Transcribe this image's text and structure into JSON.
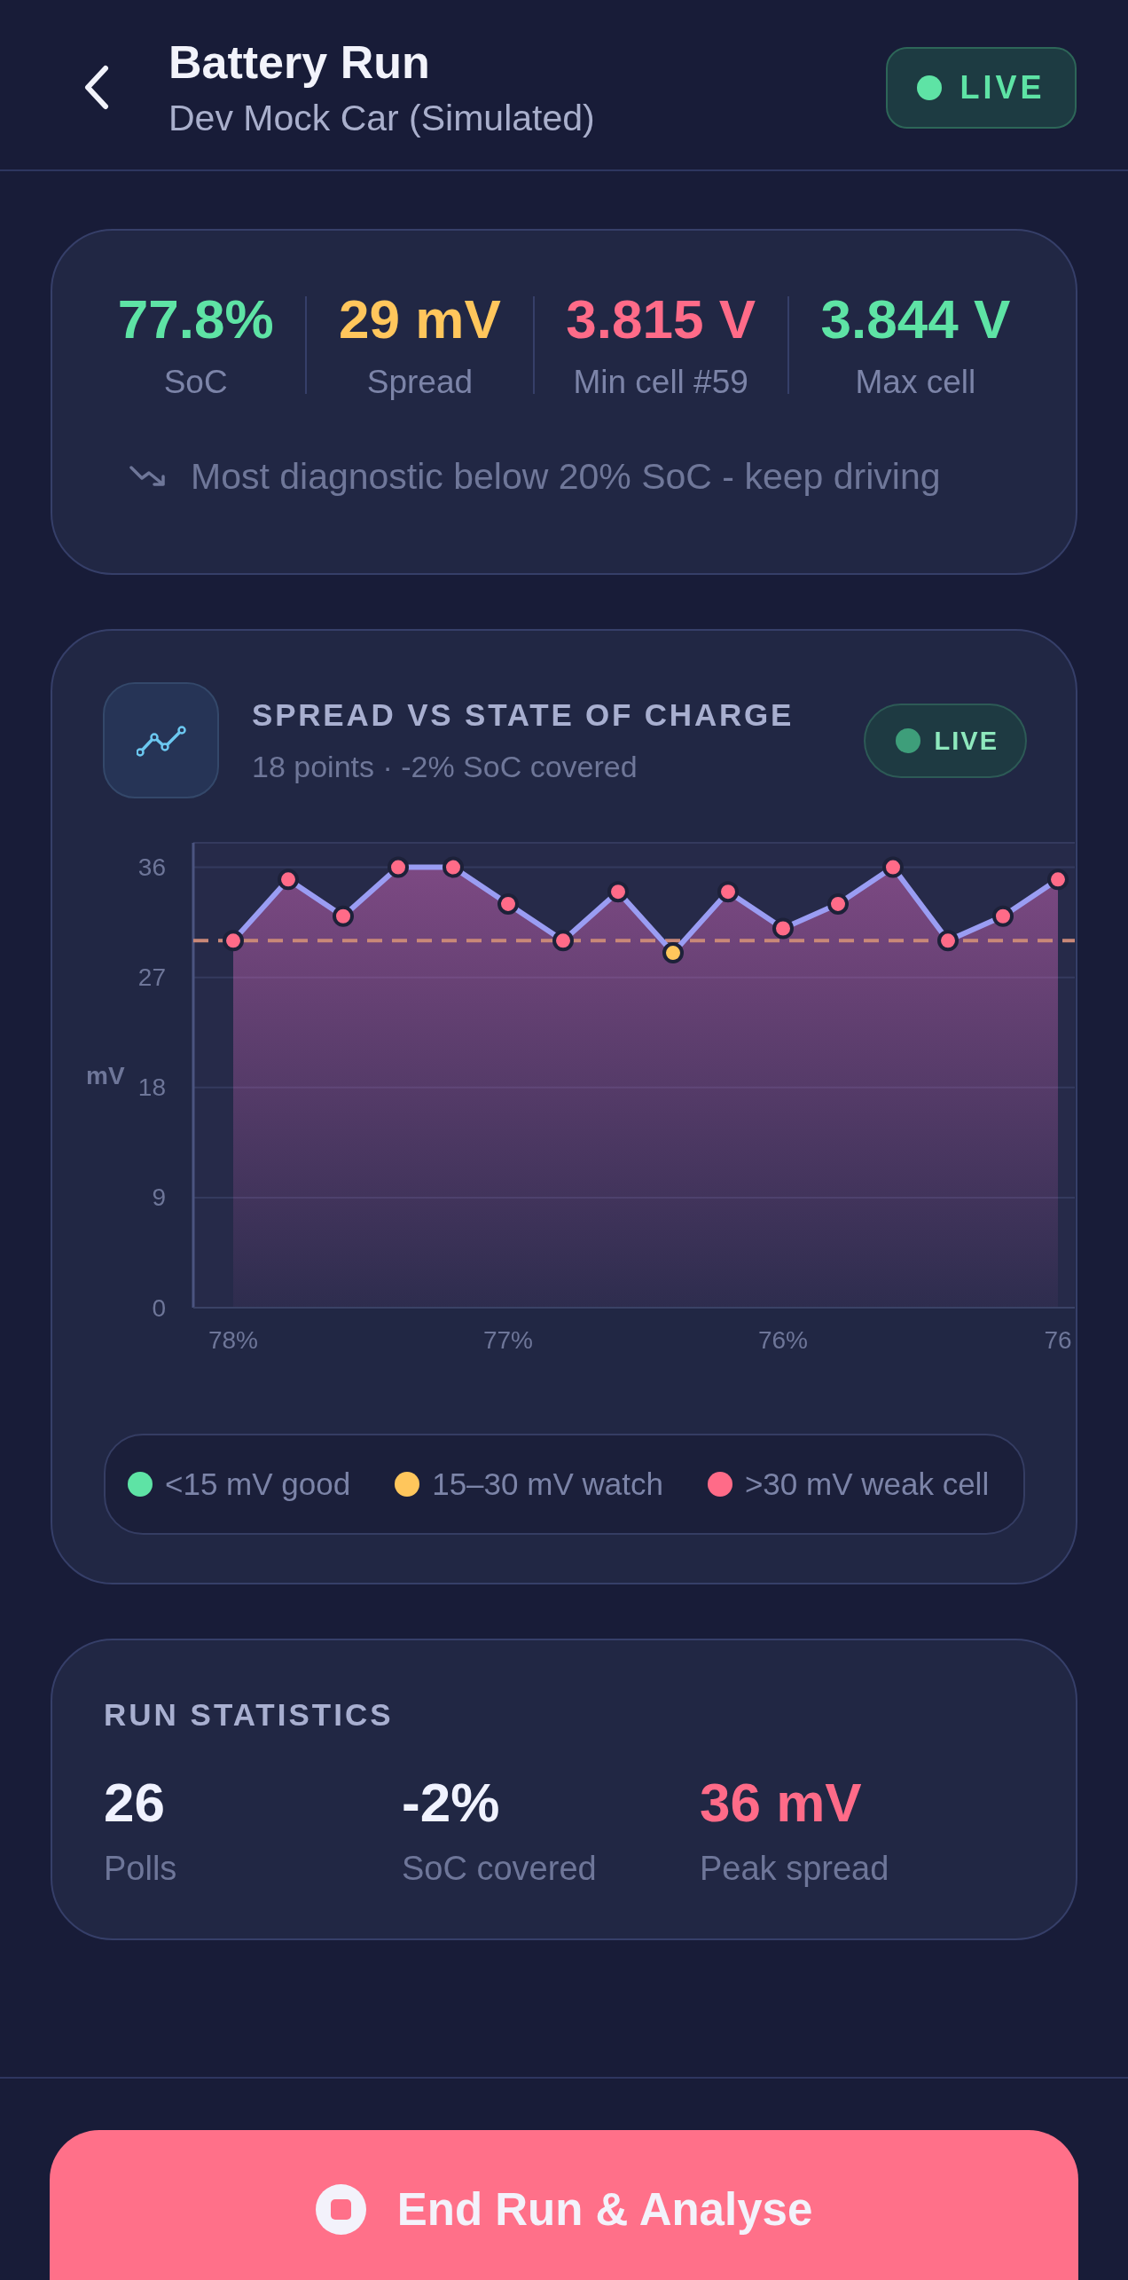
{
  "header": {
    "title": "Battery Run",
    "subtitle": "Dev Mock Car (Simulated)",
    "badge": "LIVE"
  },
  "summary": {
    "metrics": [
      {
        "value": "77.8%",
        "label": "SoC",
        "color": "#5ee3a5"
      },
      {
        "value": "29 mV",
        "label": "Spread",
        "color": "#ffc65c"
      },
      {
        "value": "3.815 V",
        "label": "Min cell #59",
        "color": "#ff6b88"
      },
      {
        "value": "3.844 V",
        "label": "Max cell",
        "color": "#5ee3a5"
      }
    ],
    "hint": "Most diagnostic below 20% SoC - keep driving"
  },
  "chart_card": {
    "title": "SPREAD VS STATE OF CHARGE",
    "subtitle": "18 points · -2% SoC covered",
    "badge": "LIVE",
    "chart_data": {
      "type": "line",
      "ylabel": "mV",
      "categories": [
        "78%",
        null,
        null,
        null,
        null,
        "77%",
        null,
        null,
        null,
        null,
        "76%",
        null,
        null,
        null,
        null,
        "76"
      ],
      "ylim": [
        0,
        38
      ],
      "yticks": [
        0,
        9,
        18,
        27,
        36
      ],
      "grid": true,
      "series": [
        {
          "color": "#9a9df3",
          "marker": "circle",
          "values": [
            30,
            35,
            32,
            36,
            36,
            33,
            30,
            34,
            29,
            34,
            31,
            33,
            36,
            30,
            32,
            35
          ]
        }
      ],
      "ref_lines": [
        {
          "axis": "y",
          "value": 30
        }
      ]
    },
    "legend": [
      {
        "label": "<15 mV good",
        "color": "#5ee3a5"
      },
      {
        "label": "15–30 mV watch",
        "color": "#ffc65c"
      },
      {
        "label": ">30 mV weak cell",
        "color": "#ff6b88"
      }
    ]
  },
  "run_statistics": {
    "title": "RUN STATISTICS",
    "stats": [
      {
        "value": "26",
        "label": "Polls",
        "color": "#f0f2ff"
      },
      {
        "value": "-2%",
        "label": "SoC covered",
        "color": "#f0f2ff"
      },
      {
        "value": "36 mV",
        "label": "Peak spread",
        "color": "#ff6b88"
      }
    ]
  },
  "action": {
    "label": "End Run & Analyse"
  }
}
